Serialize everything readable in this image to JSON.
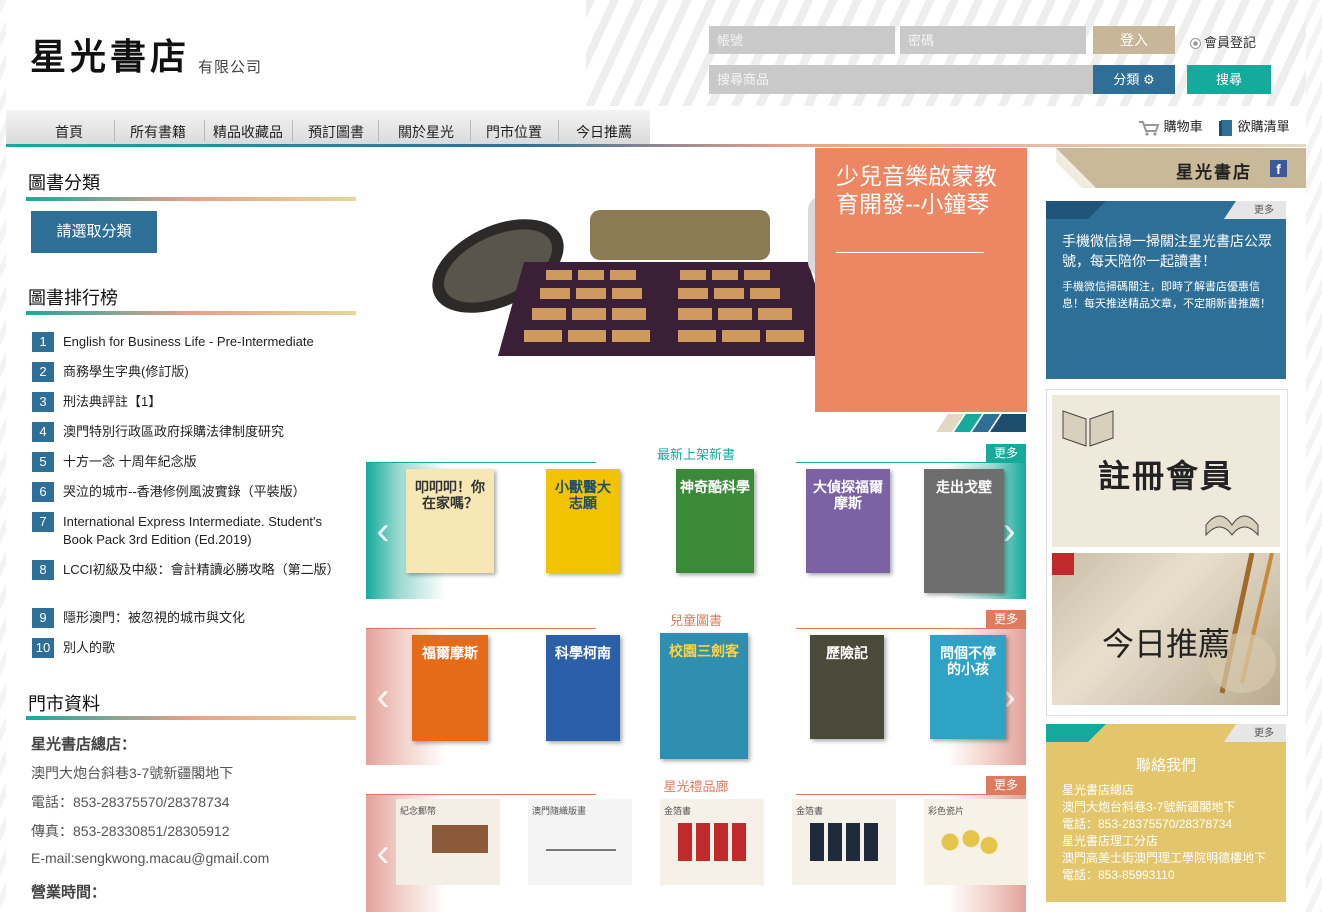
{
  "brand": {
    "logo_text": "星光書店",
    "logo_sub": "有限公司"
  },
  "auth": {
    "account_placeholder": "帳號",
    "password_placeholder": "密碼",
    "login_label": "登入",
    "register_label": "會員登記"
  },
  "search": {
    "placeholder": "搜尋商品",
    "category_label": "分類 ⚙",
    "search_label": "搜尋"
  },
  "nav": {
    "items": [
      "首頁",
      "所有書籍",
      "精品收藏品",
      "預訂圖書",
      "關於星光",
      "門市位置",
      "今日推薦"
    ],
    "cart_label": "購物車",
    "wishlist_label": "欲購清單"
  },
  "sidebar": {
    "categories_title": "圖書分類",
    "choose_category_label": "請選取分類",
    "ranking_title": "圖書排行榜",
    "ranking": [
      {
        "n": "1",
        "title": "English for Business Life - Pre-Intermediate"
      },
      {
        "n": "2",
        "title": "商務學生字典(修訂版)"
      },
      {
        "n": "3",
        "title": "刑法典評註【1】"
      },
      {
        "n": "4",
        "title": "澳門特別行政區政府採購法律制度研究"
      },
      {
        "n": "5",
        "title": "十方一念 十周年紀念版"
      },
      {
        "n": "6",
        "title": "哭泣的城市--香港修例風波實錄（平裝版）"
      },
      {
        "n": "7",
        "title": "International Express Intermediate. Student's Book Pack 3rd Edition (Ed.2019)"
      },
      {
        "n": "8",
        "title": "LCCI初級及中級：會計精讀必勝攻略（第二版）"
      },
      {
        "n": "9",
        "title": "隱形澳門：被忽視的城市與文化"
      },
      {
        "n": "10",
        "title": "別人的歌"
      }
    ],
    "store_title": "門市資料",
    "store": {
      "name": "星光書店總店：",
      "address": "澳門大炮台斜巷3-7號新疆閣地下",
      "phone": "電話：853-28375570/28378734",
      "fax": "傳真：853-28330851/28305912",
      "email": "E-mail:sengkwong.macau@gmail.com",
      "hours_label": "營業時間："
    }
  },
  "banner": {
    "title": "少兒音樂啟蒙教育開發--小鐘琴"
  },
  "shelves": [
    {
      "title": "最新上架新書",
      "more": "更多",
      "color": "#16aa9c",
      "books": [
        {
          "label": "叩叩叩！你在家嗎？",
          "color": "#6cc4b3"
        },
        {
          "label": "小獸醫大志願",
          "color": "#f2c300"
        },
        {
          "label": "神奇酷科學",
          "color": "#3b8a3a"
        },
        {
          "label": "大偵探福爾摩斯",
          "color": "#7a62a5"
        },
        {
          "label": "走出戈壁",
          "color": "#6e6e6e"
        }
      ]
    },
    {
      "title": "兒童圖書",
      "more": "更多",
      "color": "#e07a5f",
      "books": [
        {
          "label": "福爾摩斯",
          "color": "#e56a1a"
        },
        {
          "label": "科學柯南",
          "color": "#2b5fa8"
        },
        {
          "label": "校園三劍客",
          "color": "#2e8fb0"
        },
        {
          "label": "歷險記",
          "color": "#4a4a3a"
        },
        {
          "label": "問個不停的小孩",
          "color": "#2ea3c5"
        }
      ]
    },
    {
      "title": "星光禮品廊",
      "more": "更多",
      "color": "#e07a5f",
      "books": [
        {
          "label": "紀念郵幣",
          "color": "#f4efe6"
        },
        {
          "label": "澳門隨織版畫",
          "color": "#f4f4f4"
        },
        {
          "label": "金箔書",
          "color": "#f6f1e8"
        },
        {
          "label": "金箔書",
          "color": "#f6f1e8"
        },
        {
          "label": "彩色瓷片",
          "color": "#f7f2e6"
        }
      ]
    }
  ],
  "right": {
    "logo_text": "星光書店",
    "fb_icon": "f",
    "wechat": {
      "more": "更多",
      "heading": "手機微信掃一掃關注星光書店公眾號，每天陪你一起讀書！",
      "body": "手機微信掃碼關注，即時了解書店優惠信息！每天推送精品文章，不定期新書推薦！"
    },
    "register_banner": "註冊會員",
    "today_banner": "今日推薦",
    "contact": {
      "more": "更多",
      "title": "聯絡我們",
      "lines": [
        "星光書店總店",
        "澳門大炮台斜巷3-7號新疆閣地下",
        "電話：853-28375570/28378734",
        "星光書店理工分店",
        "澳門高美士街澳門理工學院明德樓地下",
        "電話：853-85993110"
      ]
    }
  }
}
